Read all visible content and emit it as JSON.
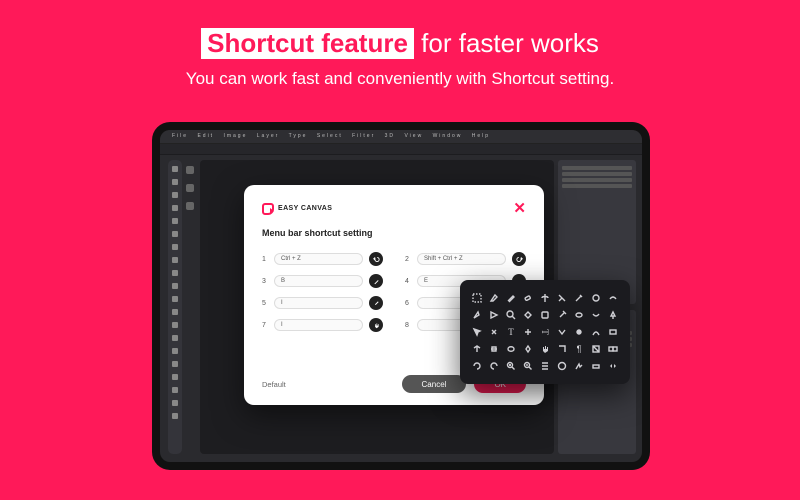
{
  "headline": {
    "highlight": "Shortcut feature",
    "rest": " for faster works"
  },
  "subline": "You can work fast and conveniently with Shortcut setting.",
  "menubar": [
    "File",
    "Edit",
    "Image",
    "Layer",
    "Type",
    "Select",
    "Filter",
    "3D",
    "View",
    "Window",
    "Help"
  ],
  "dialog": {
    "brand": "EASY CANVAS",
    "title": "Menu bar shortcut setting",
    "rows": [
      {
        "n": "1",
        "val": "Ctrl + Z",
        "icon": "undo"
      },
      {
        "n": "2",
        "val": "Shift + Ctrl + Z",
        "icon": "redo"
      },
      {
        "n": "3",
        "val": "B",
        "icon": "brush"
      },
      {
        "n": "4",
        "val": "E",
        "icon": "eraser"
      },
      {
        "n": "5",
        "val": "I",
        "icon": "eyedrop"
      },
      {
        "n": "6",
        "val": "",
        "icon": ""
      },
      {
        "n": "7",
        "val": "I",
        "icon": "hand"
      },
      {
        "n": "8",
        "val": "",
        "icon": ""
      }
    ],
    "default_label": "Default",
    "cancel": "Cancel",
    "ok": "OK"
  },
  "iconpanel_rows": 5,
  "iconpanel_cols": 9
}
